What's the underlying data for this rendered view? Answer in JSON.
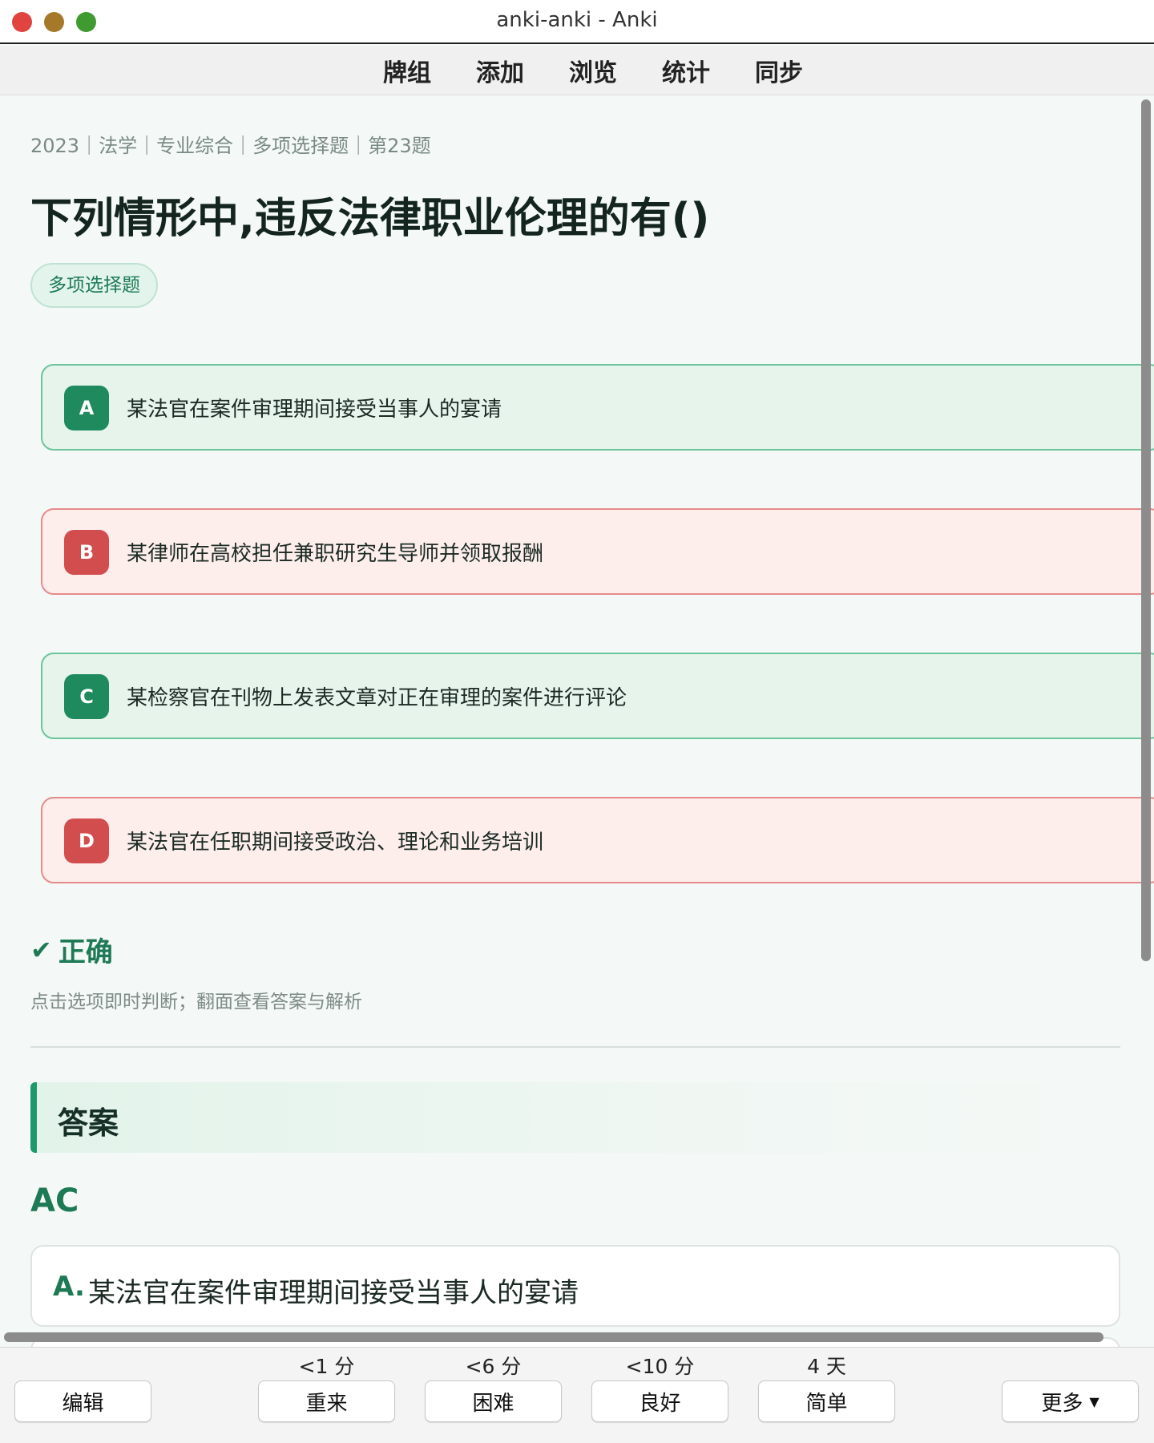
{
  "window": {
    "title": "anki-anki - Anki"
  },
  "toolbar": {
    "items": [
      "牌组",
      "添加",
      "浏览",
      "统计",
      "同步"
    ]
  },
  "card": {
    "meta": "2023｜法学｜专业综合｜多项选择题｜第23题",
    "question": "下列情形中,违反法律职业伦理的有()",
    "type_badge": "多项选择题",
    "options": [
      {
        "letter": "A",
        "text": "某法官在案件审理期间接受当事人的宴请",
        "state": "correct"
      },
      {
        "letter": "B",
        "text": "某律师在高校担任兼职研究生导师并领取报酬",
        "state": "wrong"
      },
      {
        "letter": "C",
        "text": "某检察官在刊物上发表文章对正在审理的案件进行评论",
        "state": "correct"
      },
      {
        "letter": "D",
        "text": "某法官在任职期间接受政治、理论和业务培训",
        "state": "wrong"
      }
    ],
    "result": {
      "icon": "✔",
      "label": "正确"
    },
    "hint": "点击选项即时判断；翻面查看答案与解析",
    "answer_heading": "答案",
    "answer_value": "AC",
    "explanation": {
      "letter": "A.",
      "text": "某法官在案件审理期间接受当事人的宴请"
    }
  },
  "bottom": {
    "edit_label": "编辑",
    "more_label": "更多",
    "more_icon": "▼",
    "answers": [
      {
        "label": "重来",
        "interval": "<1 分"
      },
      {
        "label": "困难",
        "interval": "<6 分"
      },
      {
        "label": "良好",
        "interval": "<10 分"
      },
      {
        "label": "简单",
        "interval": "4 天"
      }
    ]
  },
  "colors": {
    "correct": "#1e8a5e",
    "wrong": "#d24e4e",
    "accent": "#1e9a6a"
  }
}
